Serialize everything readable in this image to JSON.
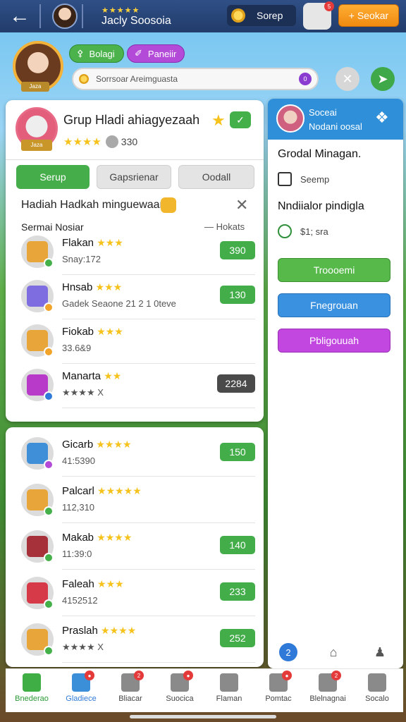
{
  "topbar": {
    "player_stars": "★★★★★",
    "player_name": "Jacly Soosoia",
    "coin_label": "Sorep",
    "profile_badge": "5",
    "seekar_label": "+ Seokar"
  },
  "scene": {
    "avatar_tag": "Jaza",
    "pill_green": "Bolagi",
    "pill_purple": "Paneiir",
    "search_text": "Sorrsoar Areimguasta",
    "search_badge": "0"
  },
  "group": {
    "tag": "Jaza",
    "title": "Grup Hladi ahiagyezaah",
    "stars": "★★★★",
    "rating": "330",
    "tabs": [
      "Serup",
      "Gapsrienar",
      "Oodall"
    ],
    "section_title": "Hadiah Hadkah minguewaan",
    "sub_left": "Sermai Nosiar",
    "sub_right": "— Hokats"
  },
  "rows_main": [
    {
      "name": "Flakan",
      "stars": "★★★",
      "sub": "Snay:172",
      "value": "390",
      "color": "#e8a63a",
      "chip": "#43b04a",
      "dark": false
    },
    {
      "name": "Hnsab",
      "stars": "★★★",
      "sub": "Gadek Seaone  21 2 1 0teve",
      "value": "130",
      "color": "#7d6de0",
      "chip": "#f2a32a",
      "dark": false
    },
    {
      "name": "Fiokab",
      "stars": "★★★",
      "sub": "33.6&9",
      "value": "",
      "color": "#e8a63a",
      "chip": "#f2a32a",
      "dark": false
    },
    {
      "name": "Manarta",
      "stars": "★★",
      "sub": "★★★★ X",
      "value": "2284",
      "color": "#b83ac8",
      "chip": "#2f7ad8",
      "dark": true
    }
  ],
  "rows_second": [
    {
      "name": "Gicarb",
      "stars": "★★★★",
      "sub": "41:5390",
      "value": "150",
      "color": "#3f8fd8",
      "chip": "#b34ad8"
    },
    {
      "name": "Palcarl",
      "stars": "★★★★★",
      "sub": "112,310",
      "value": "",
      "color": "#e8a63a",
      "chip": "#43b04a"
    },
    {
      "name": "Makab",
      "stars": "★★★★",
      "sub": "11:39:0",
      "value": "140",
      "color": "#a6313a",
      "chip": "#43b04a"
    },
    {
      "name": "Faleah",
      "stars": "★★★",
      "sub": "4152512",
      "value": "233",
      "color": "#d63a48",
      "chip": "#43b04a"
    },
    {
      "name": "Praslah",
      "stars": "★★★★",
      "sub": "★★★★ X",
      "value": "252",
      "color": "#e8a63a",
      "chip": "#43b04a"
    }
  ],
  "right_panel": {
    "header_line1": "Soceai",
    "header_line2": "Nodani oosal",
    "title1": "Grodal Minagan.",
    "row1": "Seemp",
    "title2": "Nndiialor pindigla",
    "row2": "$1; sra",
    "btn_green": "Troooemi",
    "btn_blue": "Fnegrouan",
    "btn_purple": "Pbligouuah",
    "foot_badge": "2"
  },
  "bottom_nav": [
    {
      "label": "Bnederao",
      "style": "active",
      "icon_color": "#3fae44",
      "badge": ""
    },
    {
      "label": "Gladiece",
      "style": "active2",
      "icon_color": "#3a8fd8",
      "badge": "●"
    },
    {
      "label": "Bliacar",
      "style": "",
      "icon_color": "#8a8a8a",
      "badge": "2"
    },
    {
      "label": "Suocica",
      "style": "",
      "icon_color": "#8a8a8a",
      "badge": "●"
    },
    {
      "label": "Flaman",
      "style": "",
      "icon_color": "#8a8a8a",
      "badge": ""
    },
    {
      "label": "Pomtac",
      "style": "",
      "icon_color": "#8a8a8a",
      "badge": "●"
    },
    {
      "label": "Blelnagnai",
      "style": "",
      "icon_color": "#8a8a8a",
      "badge": "2"
    },
    {
      "label": "Socalo",
      "style": "",
      "icon_color": "#8a8a8a",
      "badge": ""
    }
  ],
  "colors": {
    "accent_green": "#43b04a",
    "accent_blue": "#2f8fd8",
    "accent_purple": "#c247e0",
    "accent_orange": "#f08a10"
  }
}
